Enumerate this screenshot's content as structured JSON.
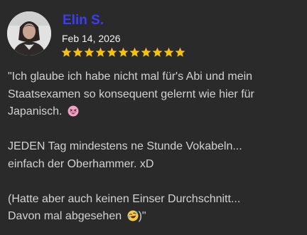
{
  "review": {
    "author_name": "Elin S.",
    "date": "Feb 14, 2026",
    "rating": 11,
    "star_color": "#f5c211",
    "name_color": "#3a3df2",
    "paragraphs": [
      {
        "lines": [
          "\"Ich glaube ich habe nicht mal für's Abi und mein",
          "Staatsexamen so konsequent gelernt wie hier für",
          "Japanisch."
        ],
        "trailing_emoji": "grinning-squinting-face-emoji"
      },
      {
        "lines": [
          "JEDEN Tag mindestens ne Stunde Vokabeln...",
          "einfach der Oberhammer. xD"
        ]
      },
      {
        "lines": [
          "(Hatte aber auch keinen Einser Durchschnitt...",
          "Davon mal abgesehen"
        ],
        "trailing_emoji": "rolling-on-floor-laughing-emoji",
        "suffix": ")\""
      }
    ]
  }
}
